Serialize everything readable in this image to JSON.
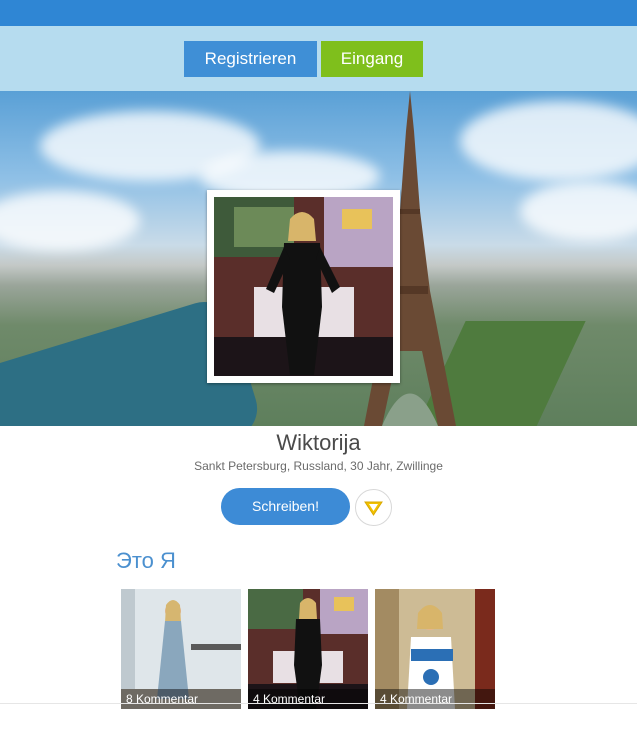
{
  "auth": {
    "register_label": "Registrieren",
    "login_label": "Eingang"
  },
  "profile": {
    "name": "Wiktorija",
    "details": "Sankt Petersburg, Russland, 30 Jahr, Zwillinge",
    "write_label": "Schreiben!",
    "vip_icon": "v-badge-icon"
  },
  "about": {
    "title": "Это Я",
    "photos": [
      {
        "caption": "8 Kommentar"
      },
      {
        "caption": "4 Kommentar"
      },
      {
        "caption": "4 Kommentar"
      }
    ]
  },
  "colors": {
    "topbar": "#2f86d4",
    "authbar": "#b6dcef",
    "register": "#3f8fd6",
    "login": "#7fbf1c",
    "accent": "#3d8bd6",
    "vip": "#f2c200"
  }
}
